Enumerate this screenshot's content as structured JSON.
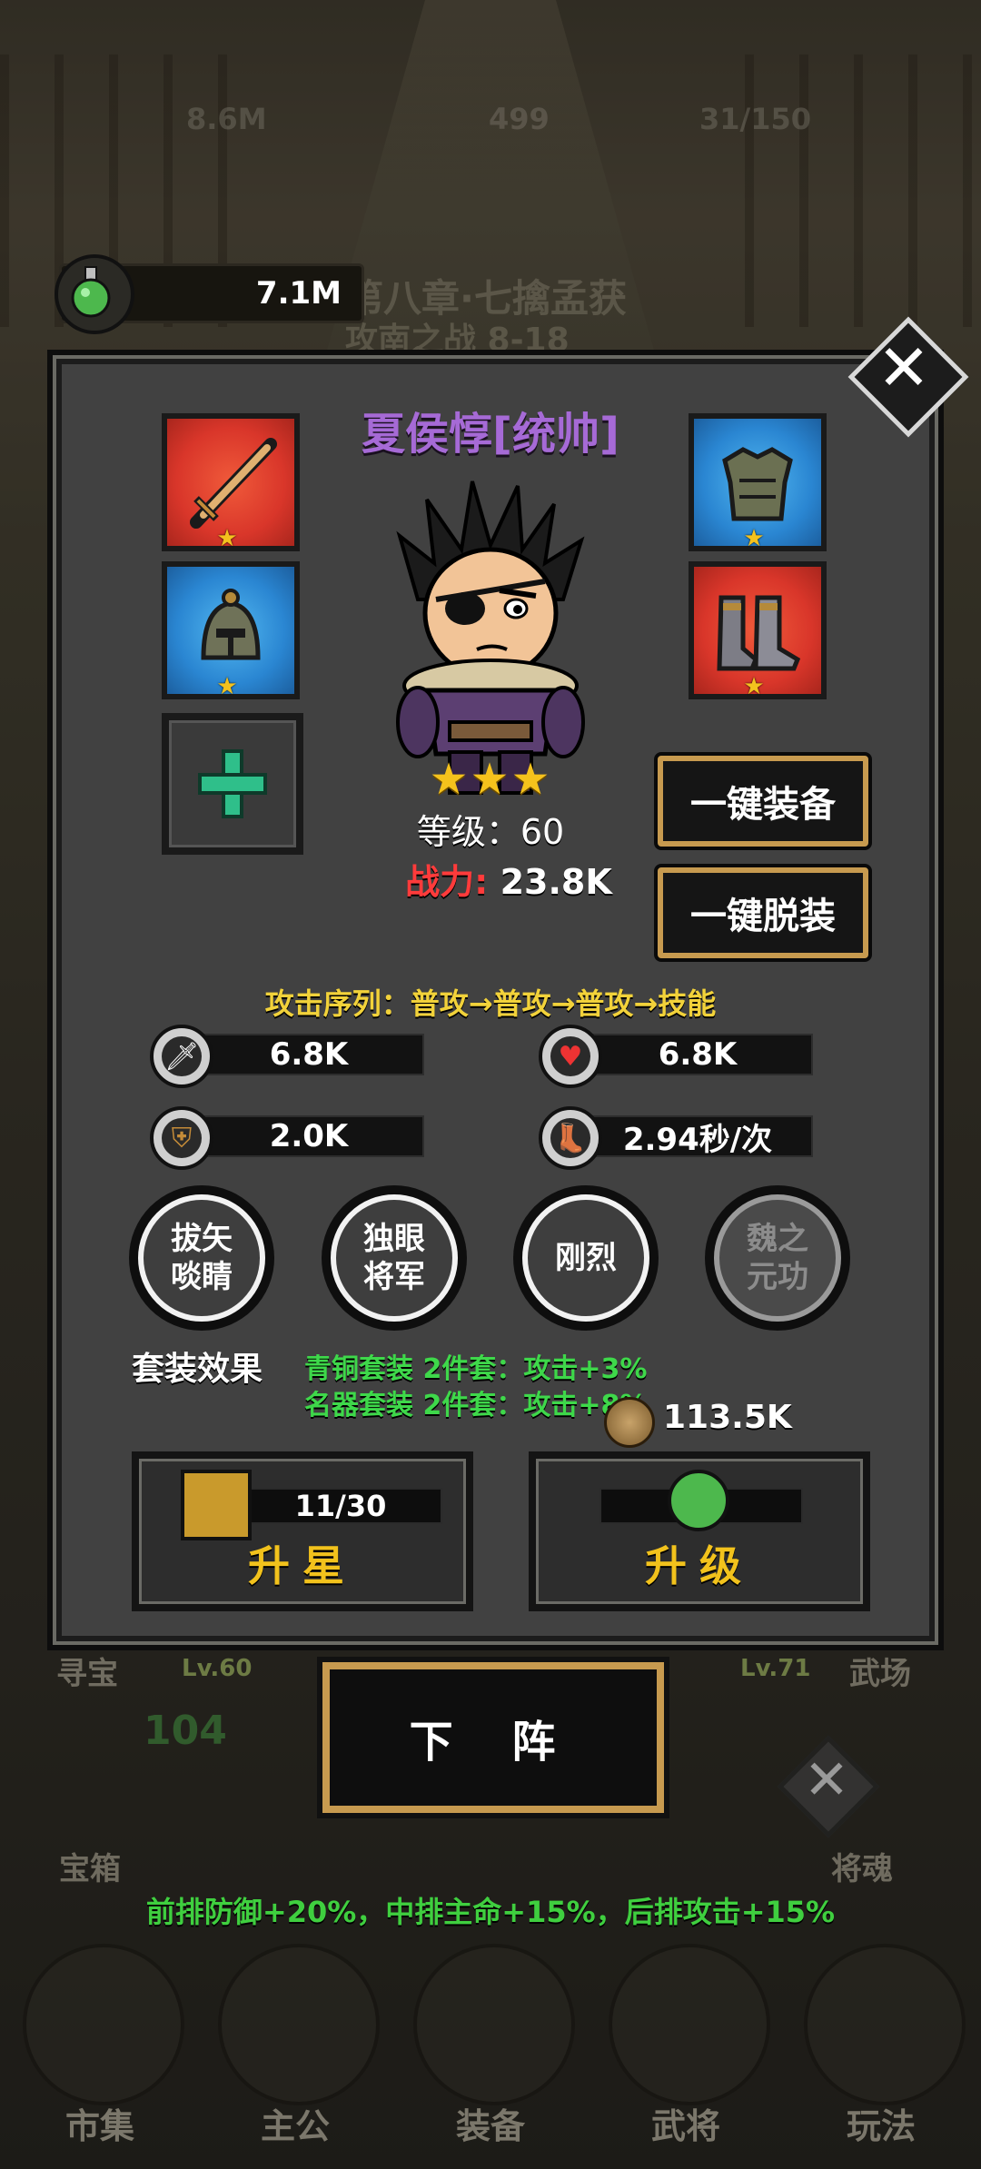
{
  "background": {
    "top_stats": [
      "8.6M",
      "499",
      "31/150"
    ],
    "chapter_line1": "第八章·七擒孟获",
    "chapter_line2": "攻南之战 8-18",
    "left_label": "寻宝",
    "right_label": "武场",
    "left_level": "Lv.60",
    "right_level": "Lv.71",
    "chest_count": "104",
    "chest_label": "宝箱",
    "soul_label": "将魂"
  },
  "potion": {
    "value": "7.1M"
  },
  "hero": {
    "name": "夏侯惇[统帅]",
    "stars": "★★★",
    "level_text": "等级：60",
    "power_label": "战力:",
    "power_value": "23.8K"
  },
  "equipment": {
    "star": "★",
    "slots": [
      {
        "name": "sword",
        "color": "red"
      },
      {
        "name": "helmet",
        "color": "blue"
      },
      {
        "name": "armor",
        "color": "blue"
      },
      {
        "name": "boots",
        "color": "red"
      }
    ],
    "empty_slot_icon": "plus-icon"
  },
  "buttons": {
    "equip_all": "一键装备",
    "unequip_all": "一键脱装",
    "remove_from_lineup": "下 阵"
  },
  "attack_sequence": "攻击序列：普攻→普攻→普攻→技能",
  "stats": {
    "attack": "6.8K",
    "hp": "6.8K",
    "defense": "2.0K",
    "speed": "2.94秒/次"
  },
  "skills": [
    {
      "line1": "拔矢",
      "line2": "啖睛",
      "locked": false
    },
    {
      "line1": "独眼",
      "line2": "将军",
      "locked": false
    },
    {
      "line1": "刚烈",
      "line2": "",
      "locked": false
    },
    {
      "line1": "魏之",
      "line2": "元功",
      "locked": true
    }
  ],
  "set_effect": {
    "title": "套装效果",
    "line1": "青铜套装 2件套：攻击+3%",
    "line2": "名器套装 2件套：攻击+8%"
  },
  "coins": "113.5K",
  "star_up": {
    "progress": "11/30",
    "label": "升星"
  },
  "level_up": {
    "progress": "0",
    "label": "升级"
  },
  "formation_bonus": "前排防御+20%，中排主命+15%，后排攻击+15%",
  "nav": [
    "市集",
    "主公",
    "装备",
    "武将",
    "玩法"
  ],
  "colors": {
    "accent_gold": "#c79a4f",
    "name_purple": "#a66ad6",
    "power_red": "#ff3b3b",
    "bonus_green": "#3fcf3f",
    "seq_yellow": "#f2d23a"
  }
}
